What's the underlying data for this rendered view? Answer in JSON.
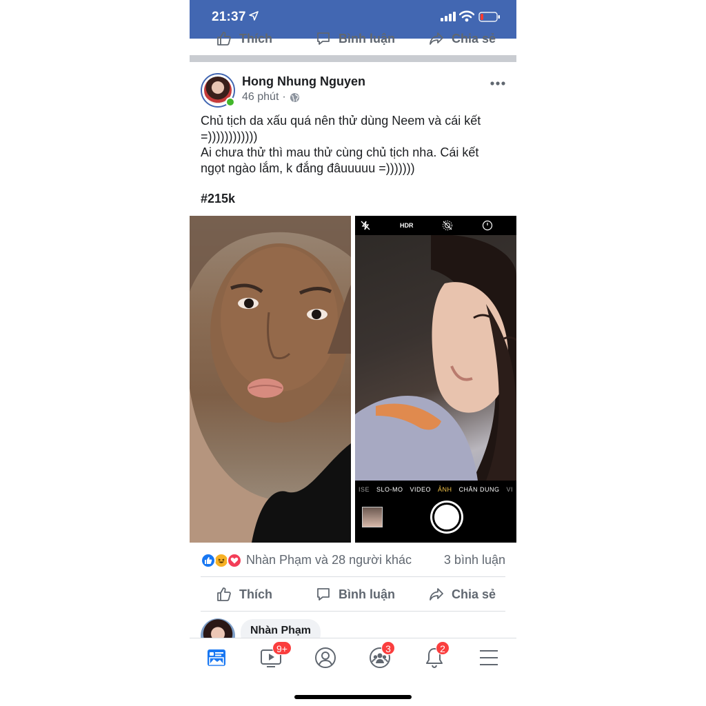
{
  "status_bar": {
    "time": "21:37",
    "background": "#4267b2"
  },
  "previous_post": {
    "actions": {
      "like_label": "Thích",
      "comment_label": "Bình luận",
      "share_label": "Chia sẻ"
    }
  },
  "post": {
    "author": "Hong Nhung Nguyen",
    "time": "46 phút",
    "separator": "·",
    "privacy_icon": "globe-icon",
    "text_lines": [
      "Chủ tịch da xấu quá nên thử dùng Neem và cái kết",
      "=))))))))))))",
      "Ai chưa thử thì mau thử cùng chủ tịch nha. Cái kết",
      "ngọt ngào lắm, k đắng đâuuuuu =)))))))"
    ],
    "hashtag": "#215k",
    "photo_right_camera": {
      "hdr_label": "HDR",
      "modes": [
        "ISE",
        "SLO-MO",
        "VIDEO",
        "ẢNH",
        "CHÂN DUNG",
        "VI"
      ],
      "active_mode": "ẢNH"
    },
    "reactions": {
      "icons": [
        "like-icon",
        "haha-icon",
        "love-icon"
      ],
      "text": "Nhàn Phạm và 28 người khác",
      "comment_count": "3 bình luận"
    },
    "actions": {
      "like_label": "Thích",
      "comment_label": "Bình luận",
      "share_label": "Chia sẻ"
    },
    "comment_preview": {
      "name": "Nhàn Phạm"
    }
  },
  "tab_bar": {
    "tabs": [
      {
        "name": "news-feed",
        "icon": "news-feed-icon",
        "badge": ""
      },
      {
        "name": "watch",
        "icon": "video-icon",
        "badge": "9+"
      },
      {
        "name": "profile",
        "icon": "profile-icon",
        "badge": ""
      },
      {
        "name": "groups",
        "icon": "groups-icon",
        "badge": "3"
      },
      {
        "name": "notifications",
        "icon": "bell-icon",
        "badge": "2"
      },
      {
        "name": "menu",
        "icon": "hamburger-icon",
        "badge": ""
      }
    ],
    "accent": "#1877f2"
  }
}
